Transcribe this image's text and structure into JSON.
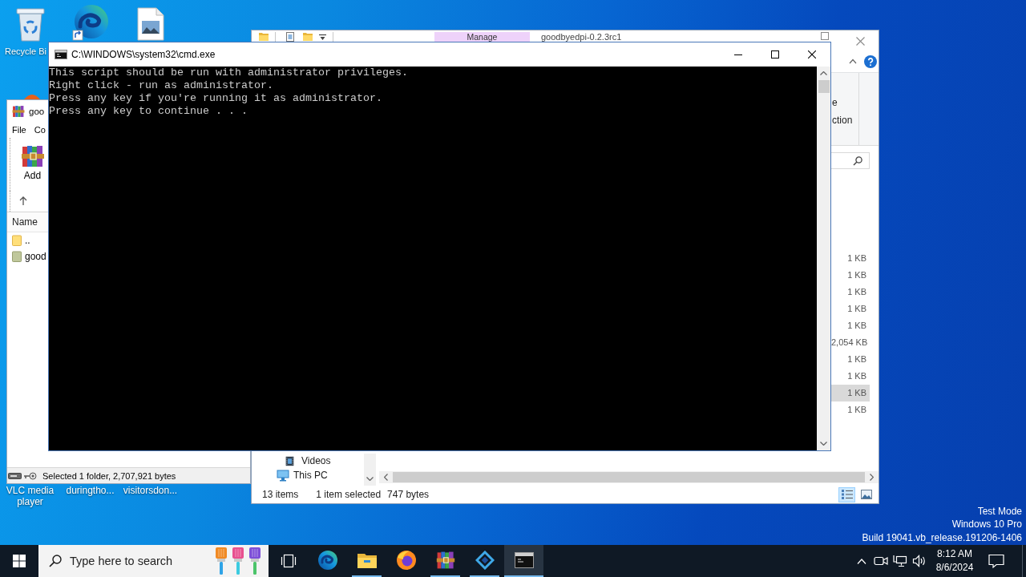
{
  "desktop": {
    "icons": [
      {
        "kind": "recycle-bin",
        "label": "Recycle Bi"
      },
      {
        "kind": "edge-shortcut"
      },
      {
        "kind": "image-file"
      }
    ],
    "bottom_labels": [
      "VLC media player",
      "duringtho...",
      "visitorsdon..."
    ],
    "system_text": [
      "Test Mode",
      "Windows 10 Pro",
      "Build 19041.vb_release.191206-1406"
    ]
  },
  "explorer": {
    "context_tab": "Manage",
    "title": "goodbyedpi-0.2.3rc1",
    "ribbon_fragments": [
      "e",
      "ction"
    ],
    "nav": [
      {
        "kind": "group",
        "children": [
          {
            "kind": "videos",
            "label": "Videos"
          }
        ]
      },
      {
        "kind": "this-pc",
        "label": "This PC"
      }
    ],
    "rows": [
      {
        "size": "1 KB",
        "selected": false
      },
      {
        "size": "1 KB",
        "selected": false
      },
      {
        "size": "1 KB",
        "selected": false
      },
      {
        "size": "1 KB",
        "selected": false
      },
      {
        "size": "1 KB",
        "selected": false
      },
      {
        "size": "2,054 KB",
        "selected": false
      },
      {
        "size": "1 KB",
        "selected": false
      },
      {
        "size": "1 KB",
        "selected": false
      },
      {
        "size": "1 KB",
        "selected": true
      },
      {
        "size": "1 KB",
        "selected": false
      }
    ],
    "status": [
      "13 items",
      "1 item selected",
      "747 bytes"
    ],
    "views": [
      {
        "kind": "details",
        "selected": true
      },
      {
        "kind": "large-icons",
        "selected": false
      }
    ]
  },
  "winrar": {
    "title": "goo",
    "menu": [
      "File",
      "Co"
    ],
    "toolbar": [
      "Add"
    ],
    "column": "Name",
    "rows": [
      {
        "kind": "parent",
        "name": ".."
      },
      {
        "kind": "archive",
        "name": "good"
      }
    ],
    "status": "Selected 1 folder, 2,707,921 bytes"
  },
  "cmd": {
    "title": "C:\\WINDOWS\\system32\\cmd.exe",
    "lines": [
      "This script should be run with administrator privileges.",
      "Right click - run as administrator.",
      "Press any key if you're running it as administrator.",
      "Press any key to continue . . ."
    ]
  },
  "taskbar": {
    "search_placeholder": "Type here to search",
    "apps": [
      {
        "kind": "edge",
        "running": false,
        "selected": false
      },
      {
        "kind": "file-explorer",
        "running": true,
        "selected": false
      },
      {
        "kind": "firefox",
        "running": false,
        "selected": false
      },
      {
        "kind": "winrar",
        "running": true,
        "selected": false
      },
      {
        "kind": "diamond",
        "running": true,
        "selected": false
      },
      {
        "kind": "console",
        "running": true,
        "selected": true
      }
    ],
    "time": "8:12 AM",
    "date": "8/6/2024"
  }
}
